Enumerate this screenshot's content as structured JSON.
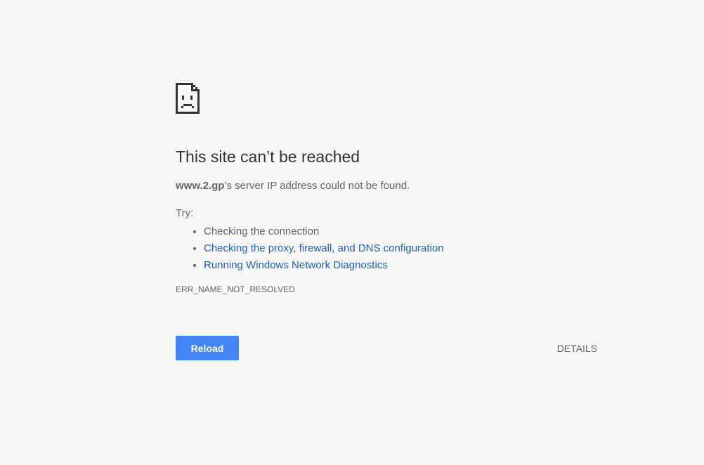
{
  "error": {
    "icon": "sad-page-icon",
    "title": "This site can’t be reached",
    "host": "www.2.gp",
    "summary_suffix": "’s server IP address could not be found.",
    "try_label": "Try:",
    "suggestions": [
      {
        "text": "Checking the connection",
        "is_link": false
      },
      {
        "text": "Checking the proxy, firewall, and DNS configuration",
        "is_link": true
      },
      {
        "text": "Running Windows Network Diagnostics",
        "is_link": true
      }
    ],
    "code": "ERR_NAME_NOT_RESOLVED"
  },
  "buttons": {
    "reload_label": "Reload",
    "details_label": "DETAILS"
  },
  "colors": {
    "background": "#f7f7f7",
    "title": "#333333",
    "text": "#646464",
    "link": "#1e5ec4",
    "primary_button": "#4285f4"
  }
}
